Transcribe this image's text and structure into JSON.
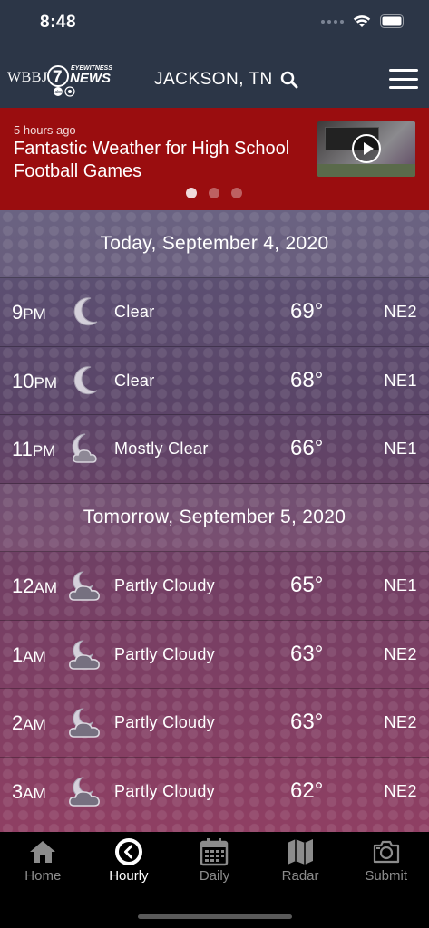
{
  "status_bar": {
    "time": "8:48"
  },
  "header": {
    "logo_text": "WBBJ 7 EYEWITNESS NEWS",
    "location": "JACKSON, TN"
  },
  "news": {
    "time_ago": "5 hours ago",
    "headline": "Fantastic Weather for High School Football Games",
    "carousel": {
      "count": 3,
      "active_index": 0
    }
  },
  "forecast": {
    "days": [
      {
        "date": "Today, September 4, 2020",
        "hours": [
          {
            "hour": "9",
            "ampm": "PM",
            "icon": "moon-icon",
            "condition": "Clear",
            "temp": "69°",
            "wind": "NE2"
          },
          {
            "hour": "10",
            "ampm": "PM",
            "icon": "moon-icon",
            "condition": "Clear",
            "temp": "68°",
            "wind": "NE1"
          },
          {
            "hour": "11",
            "ampm": "PM",
            "icon": "moon-cloud-icon",
            "condition": "Mostly Clear",
            "temp": "66°",
            "wind": "NE1"
          }
        ]
      },
      {
        "date": "Tomorrow, September 5, 2020",
        "hours": [
          {
            "hour": "12",
            "ampm": "AM",
            "icon": "partly-cloudy-night-icon",
            "condition": "Partly Cloudy",
            "temp": "65°",
            "wind": "NE1"
          },
          {
            "hour": "1",
            "ampm": "AM",
            "icon": "partly-cloudy-night-icon",
            "condition": "Partly Cloudy",
            "temp": "63°",
            "wind": "NE2"
          },
          {
            "hour": "2",
            "ampm": "AM",
            "icon": "partly-cloudy-night-icon",
            "condition": "Partly Cloudy",
            "temp": "63°",
            "wind": "NE2"
          },
          {
            "hour": "3",
            "ampm": "AM",
            "icon": "partly-cloudy-night-icon",
            "condition": "Partly Cloudy",
            "temp": "62°",
            "wind": "NE2"
          }
        ]
      }
    ]
  },
  "tabs": [
    {
      "label": "Home",
      "icon": "home-icon",
      "active": false
    },
    {
      "label": "Hourly",
      "icon": "clock-icon",
      "active": true
    },
    {
      "label": "Daily",
      "icon": "calendar-icon",
      "active": false
    },
    {
      "label": "Radar",
      "icon": "map-icon",
      "active": false
    },
    {
      "label": "Submit",
      "icon": "camera-icon",
      "active": false
    }
  ],
  "colors": {
    "header_bg": "#2c3647",
    "banner_bg": "#9a0d0f",
    "active_tab": "#ffffff",
    "inactive_tab": "#8c8c8c"
  }
}
